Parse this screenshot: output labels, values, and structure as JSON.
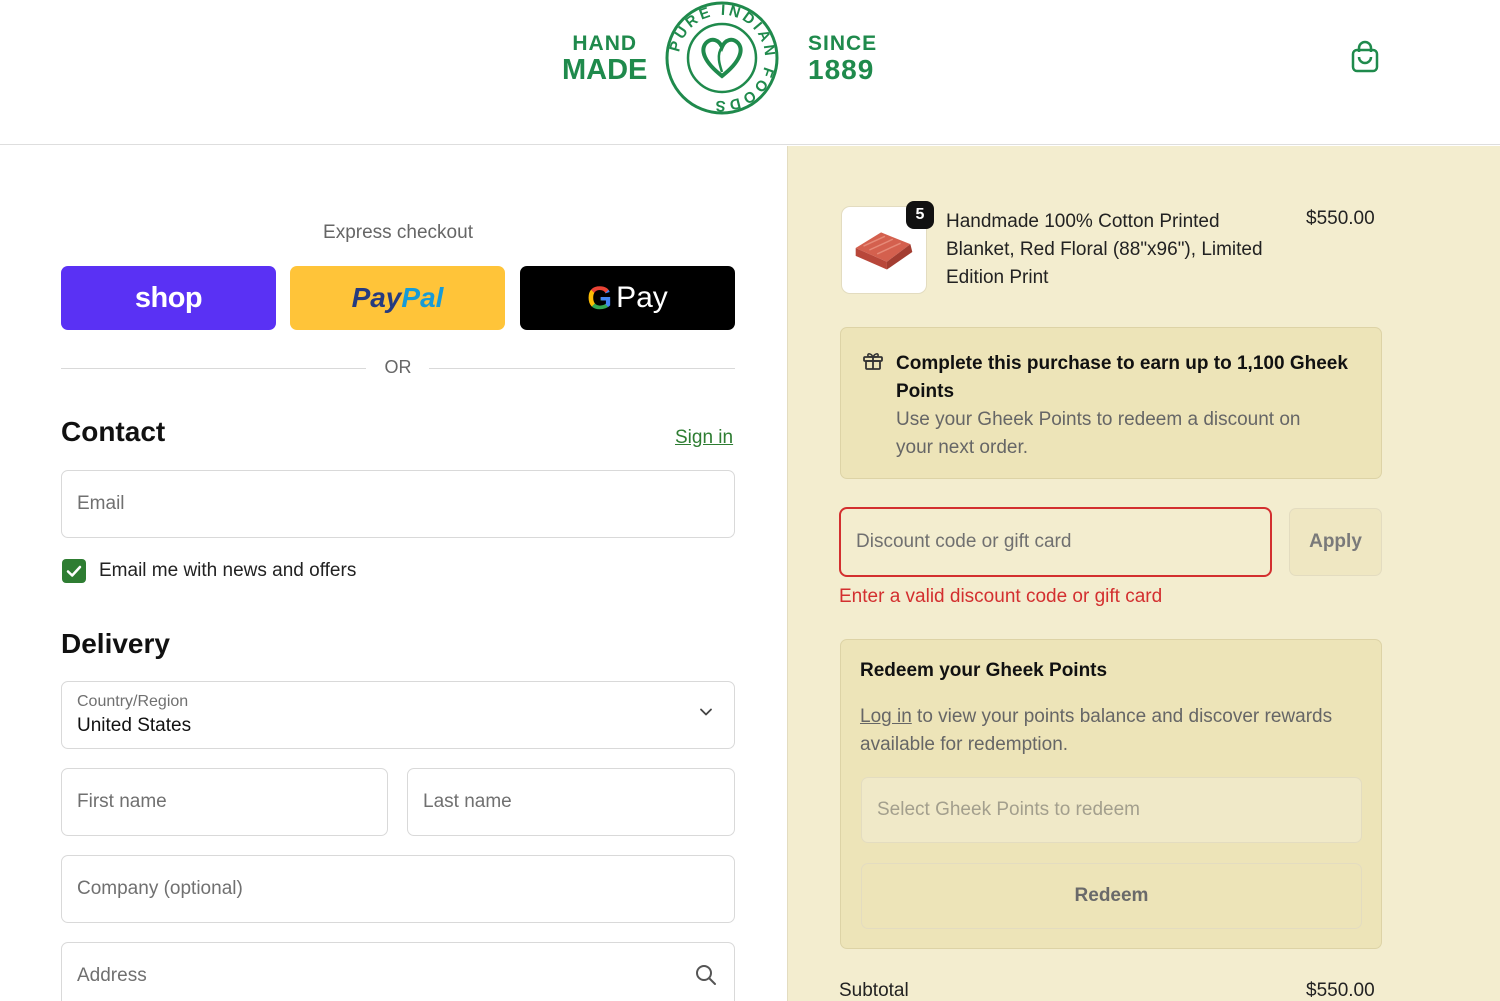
{
  "header": {
    "logo_left_line1": "HAND",
    "logo_left_line2": "MADE",
    "logo_right_line1": "SINCE",
    "logo_right_line2": "1889",
    "seal_text": "PURE INDIAN FOODS"
  },
  "express": {
    "label": "Express checkout",
    "shop_label": "shop",
    "paypal_label_a": "Pay",
    "paypal_label_b": "Pal",
    "gpay_g": "G",
    "gpay_label": "Pay",
    "or_label": "OR"
  },
  "contact": {
    "title": "Contact",
    "sign_in": "Sign in",
    "email_placeholder": "Email",
    "newsletter_label": "Email me with news and offers",
    "newsletter_checked": true
  },
  "delivery": {
    "title": "Delivery",
    "country_label": "Country/Region",
    "country_value": "United States",
    "first_name_placeholder": "First name",
    "last_name_placeholder": "Last name",
    "company_placeholder": "Company (optional)",
    "address_placeholder": "Address"
  },
  "order": {
    "product_name": "Handmade 100% Cotton Printed Blanket, Red Floral (88\"x96\"), Limited Edition Print",
    "product_price": "$550.00",
    "quantity": "5",
    "points_title": "Complete this purchase to earn up to 1,100 Gheek Points",
    "points_sub": "Use your Gheek Points to redeem a discount on your next order.",
    "discount_placeholder": "Discount code or gift card",
    "apply_label": "Apply",
    "discount_error": "Enter a valid discount code or gift card",
    "redeem_title": "Redeem your Gheek Points",
    "redeem_login": "Log in",
    "redeem_desc_rest": " to view your points balance and discover rewards available for redemption.",
    "redeem_select_placeholder": "Select Gheek Points to redeem",
    "redeem_button": "Redeem",
    "subtotal_label": "Subtotal",
    "subtotal_value": "$550.00"
  },
  "colors": {
    "brand_green": "#1f8a4c",
    "shop_purple": "#5a31f4",
    "paypal_yellow": "#ffc439",
    "error_red": "#d32f2f",
    "summary_bg": "#f3edcf"
  }
}
